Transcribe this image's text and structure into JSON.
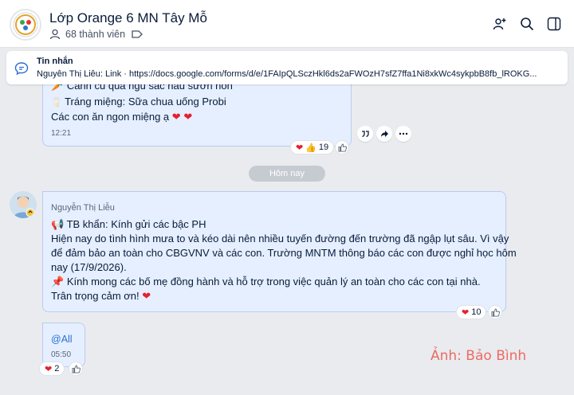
{
  "header": {
    "group_name": "Lớp Orange 6 MN Tây Mỗ",
    "member_count": "68 thành viên",
    "icons": [
      "add-member-icon",
      "search-icon",
      "sidebar-toggle-icon"
    ]
  },
  "pinned": {
    "label": "Tin nhắn",
    "text": "Nguyễn Thị Liễu:     Link · https://docs.google.com/forms/d/e/1FAIpQLSczHkl6ds2aFWOzH7sfZ7ffa1Ni8xkWc4sykpbB8fb_lROKG..."
  },
  "msg1": {
    "line1": "Canh củ quả ngũ sắc nấu sườn non",
    "line2": "Tráng miệng: Sữa chua uống Probi",
    "line3": "Các con ăn ngon miệng ạ",
    "time": "12:21",
    "reaction_count": "19"
  },
  "divider": "Hôm nay",
  "msg2": {
    "sender": "Nguyễn Thị Liễu",
    "line1": "TB khẩn: Kính gửi các bậc PH",
    "line2": "Hiện nay do tình hình mưa to và kéo dài nên nhiều tuyến đường đến trường đã ngập lụt sâu. Vì vậy",
    "line3": "để đảm bảo an toàn cho CBGVNV và các con. Trường MNTM thông báo các con được nghỉ học hôm",
    "line4": "nay (17/9/2026).",
    "line5": "Kính mong các bố mẹ đồng hành và hỗ trợ trong việc quản lý an toàn cho các con tại nhà.",
    "line6": "Trân trọng cảm ơn!",
    "reaction_count": "10"
  },
  "msg3": {
    "text": "@All",
    "time": "05:50",
    "reaction_count": "2"
  },
  "watermark": "Ảnh: Bảo Bình",
  "colors": {
    "bubble": "#e5efff",
    "accent": "#2b6fd1",
    "heart": "#e5202e",
    "watermark": "#ee6b62"
  }
}
